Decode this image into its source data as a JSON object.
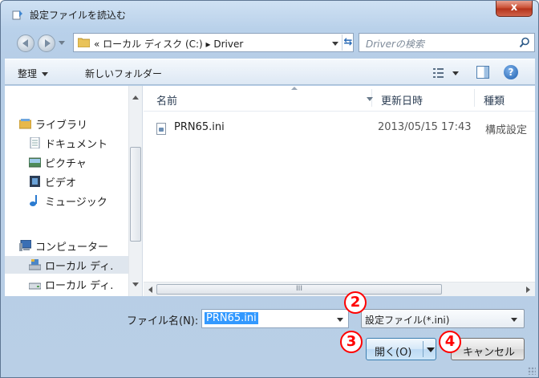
{
  "window": {
    "title": "設定ファイルを読込む",
    "close_label": "x"
  },
  "address": {
    "path_text": "« ローカル ディスク (C:) ▸ Driver",
    "search_placeholder": "Driverの検索"
  },
  "toolbar": {
    "organize_label": "整理",
    "new_folder_label": "新しいフォルダー",
    "help_label": "?"
  },
  "nav": {
    "items": [
      {
        "label": "ライブラリ",
        "icon": "library-icon"
      },
      {
        "label": "ドキュメント",
        "icon": "documents-icon"
      },
      {
        "label": "ピクチャ",
        "icon": "pictures-icon"
      },
      {
        "label": "ビデオ",
        "icon": "videos-icon"
      },
      {
        "label": "ミュージック",
        "icon": "music-icon"
      },
      {
        "label": "コンピューター",
        "icon": "computer-icon"
      },
      {
        "label": "ローカル ディ.",
        "icon": "local-disk-icon"
      },
      {
        "label": "ローカル ディ.",
        "icon": "drive-icon"
      }
    ]
  },
  "files": {
    "columns": {
      "name": "名前",
      "date": "更新日時",
      "type": "種類"
    },
    "rows": [
      {
        "name": "PRN65.ini",
        "date": "2013/05/15 17:43",
        "type": "構成設定"
      }
    ],
    "hscroll_grip": "III"
  },
  "bottom": {
    "filename_label": "ファイル名(N):",
    "filename_value": "PRN65.ini",
    "filetype_value": "設定ファイル(*.ini)",
    "open_label": "開く(O)",
    "cancel_label": "キャンセル"
  },
  "callouts": {
    "c2": "2",
    "c3": "3",
    "c4": "4"
  },
  "colors": {
    "callout": "#ff0000",
    "selection": "#3399ff",
    "close": "#c7482c"
  }
}
